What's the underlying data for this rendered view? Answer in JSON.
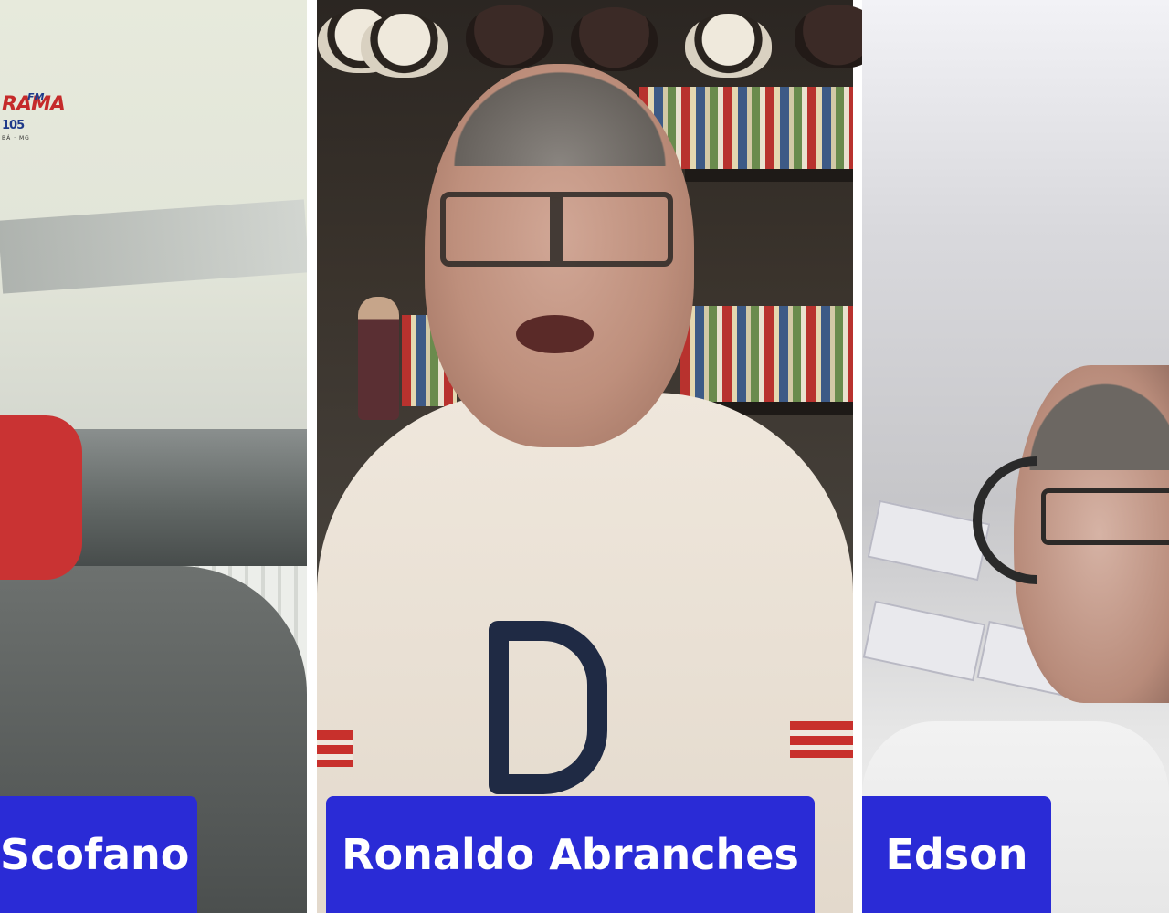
{
  "station_logo": {
    "brand": "RAMA",
    "band": "FM",
    "frequency": "105",
    "city": "BÁ · MG"
  },
  "participants": [
    {
      "name": "Scofano"
    },
    {
      "name": "Ronaldo Abranches"
    },
    {
      "name": "Edson"
    }
  ],
  "colors": {
    "name_tag_background": "#2a2bd6",
    "name_tag_text": "#ffffff",
    "logo_red": "#c52a2a",
    "logo_blue": "#1f3a8a"
  }
}
